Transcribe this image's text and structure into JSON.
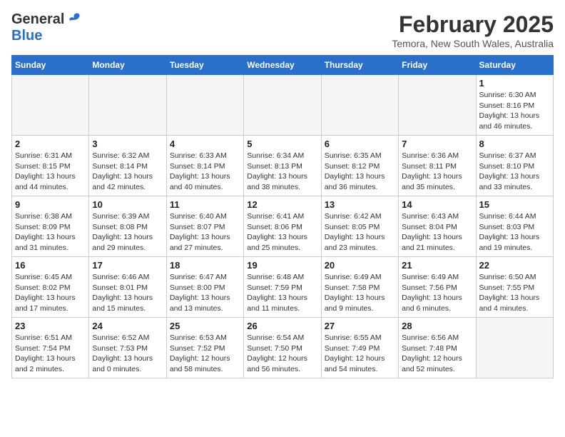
{
  "header": {
    "logo_general": "General",
    "logo_blue": "Blue",
    "month": "February 2025",
    "location": "Temora, New South Wales, Australia"
  },
  "weekdays": [
    "Sunday",
    "Monday",
    "Tuesday",
    "Wednesday",
    "Thursday",
    "Friday",
    "Saturday"
  ],
  "weeks": [
    [
      {
        "day": "",
        "empty": true
      },
      {
        "day": "",
        "empty": true
      },
      {
        "day": "",
        "empty": true
      },
      {
        "day": "",
        "empty": true
      },
      {
        "day": "",
        "empty": true
      },
      {
        "day": "",
        "empty": true
      },
      {
        "day": "1",
        "sunrise": "Sunrise: 6:30 AM",
        "sunset": "Sunset: 8:16 PM",
        "daylight": "Daylight: 13 hours and 46 minutes."
      }
    ],
    [
      {
        "day": "2",
        "sunrise": "Sunrise: 6:31 AM",
        "sunset": "Sunset: 8:15 PM",
        "daylight": "Daylight: 13 hours and 44 minutes."
      },
      {
        "day": "3",
        "sunrise": "Sunrise: 6:32 AM",
        "sunset": "Sunset: 8:14 PM",
        "daylight": "Daylight: 13 hours and 42 minutes."
      },
      {
        "day": "4",
        "sunrise": "Sunrise: 6:33 AM",
        "sunset": "Sunset: 8:14 PM",
        "daylight": "Daylight: 13 hours and 40 minutes."
      },
      {
        "day": "5",
        "sunrise": "Sunrise: 6:34 AM",
        "sunset": "Sunset: 8:13 PM",
        "daylight": "Daylight: 13 hours and 38 minutes."
      },
      {
        "day": "6",
        "sunrise": "Sunrise: 6:35 AM",
        "sunset": "Sunset: 8:12 PM",
        "daylight": "Daylight: 13 hours and 36 minutes."
      },
      {
        "day": "7",
        "sunrise": "Sunrise: 6:36 AM",
        "sunset": "Sunset: 8:11 PM",
        "daylight": "Daylight: 13 hours and 35 minutes."
      },
      {
        "day": "8",
        "sunrise": "Sunrise: 6:37 AM",
        "sunset": "Sunset: 8:10 PM",
        "daylight": "Daylight: 13 hours and 33 minutes."
      }
    ],
    [
      {
        "day": "9",
        "sunrise": "Sunrise: 6:38 AM",
        "sunset": "Sunset: 8:09 PM",
        "daylight": "Daylight: 13 hours and 31 minutes."
      },
      {
        "day": "10",
        "sunrise": "Sunrise: 6:39 AM",
        "sunset": "Sunset: 8:08 PM",
        "daylight": "Daylight: 13 hours and 29 minutes."
      },
      {
        "day": "11",
        "sunrise": "Sunrise: 6:40 AM",
        "sunset": "Sunset: 8:07 PM",
        "daylight": "Daylight: 13 hours and 27 minutes."
      },
      {
        "day": "12",
        "sunrise": "Sunrise: 6:41 AM",
        "sunset": "Sunset: 8:06 PM",
        "daylight": "Daylight: 13 hours and 25 minutes."
      },
      {
        "day": "13",
        "sunrise": "Sunrise: 6:42 AM",
        "sunset": "Sunset: 8:05 PM",
        "daylight": "Daylight: 13 hours and 23 minutes."
      },
      {
        "day": "14",
        "sunrise": "Sunrise: 6:43 AM",
        "sunset": "Sunset: 8:04 PM",
        "daylight": "Daylight: 13 hours and 21 minutes."
      },
      {
        "day": "15",
        "sunrise": "Sunrise: 6:44 AM",
        "sunset": "Sunset: 8:03 PM",
        "daylight": "Daylight: 13 hours and 19 minutes."
      }
    ],
    [
      {
        "day": "16",
        "sunrise": "Sunrise: 6:45 AM",
        "sunset": "Sunset: 8:02 PM",
        "daylight": "Daylight: 13 hours and 17 minutes."
      },
      {
        "day": "17",
        "sunrise": "Sunrise: 6:46 AM",
        "sunset": "Sunset: 8:01 PM",
        "daylight": "Daylight: 13 hours and 15 minutes."
      },
      {
        "day": "18",
        "sunrise": "Sunrise: 6:47 AM",
        "sunset": "Sunset: 8:00 PM",
        "daylight": "Daylight: 13 hours and 13 minutes."
      },
      {
        "day": "19",
        "sunrise": "Sunrise: 6:48 AM",
        "sunset": "Sunset: 7:59 PM",
        "daylight": "Daylight: 13 hours and 11 minutes."
      },
      {
        "day": "20",
        "sunrise": "Sunrise: 6:49 AM",
        "sunset": "Sunset: 7:58 PM",
        "daylight": "Daylight: 13 hours and 9 minutes."
      },
      {
        "day": "21",
        "sunrise": "Sunrise: 6:49 AM",
        "sunset": "Sunset: 7:56 PM",
        "daylight": "Daylight: 13 hours and 6 minutes."
      },
      {
        "day": "22",
        "sunrise": "Sunrise: 6:50 AM",
        "sunset": "Sunset: 7:55 PM",
        "daylight": "Daylight: 13 hours and 4 minutes."
      }
    ],
    [
      {
        "day": "23",
        "sunrise": "Sunrise: 6:51 AM",
        "sunset": "Sunset: 7:54 PM",
        "daylight": "Daylight: 13 hours and 2 minutes."
      },
      {
        "day": "24",
        "sunrise": "Sunrise: 6:52 AM",
        "sunset": "Sunset: 7:53 PM",
        "daylight": "Daylight: 13 hours and 0 minutes."
      },
      {
        "day": "25",
        "sunrise": "Sunrise: 6:53 AM",
        "sunset": "Sunset: 7:52 PM",
        "daylight": "Daylight: 12 hours and 58 minutes."
      },
      {
        "day": "26",
        "sunrise": "Sunrise: 6:54 AM",
        "sunset": "Sunset: 7:50 PM",
        "daylight": "Daylight: 12 hours and 56 minutes."
      },
      {
        "day": "27",
        "sunrise": "Sunrise: 6:55 AM",
        "sunset": "Sunset: 7:49 PM",
        "daylight": "Daylight: 12 hours and 54 minutes."
      },
      {
        "day": "28",
        "sunrise": "Sunrise: 6:56 AM",
        "sunset": "Sunset: 7:48 PM",
        "daylight": "Daylight: 12 hours and 52 minutes."
      },
      {
        "day": "",
        "empty": true
      }
    ]
  ]
}
